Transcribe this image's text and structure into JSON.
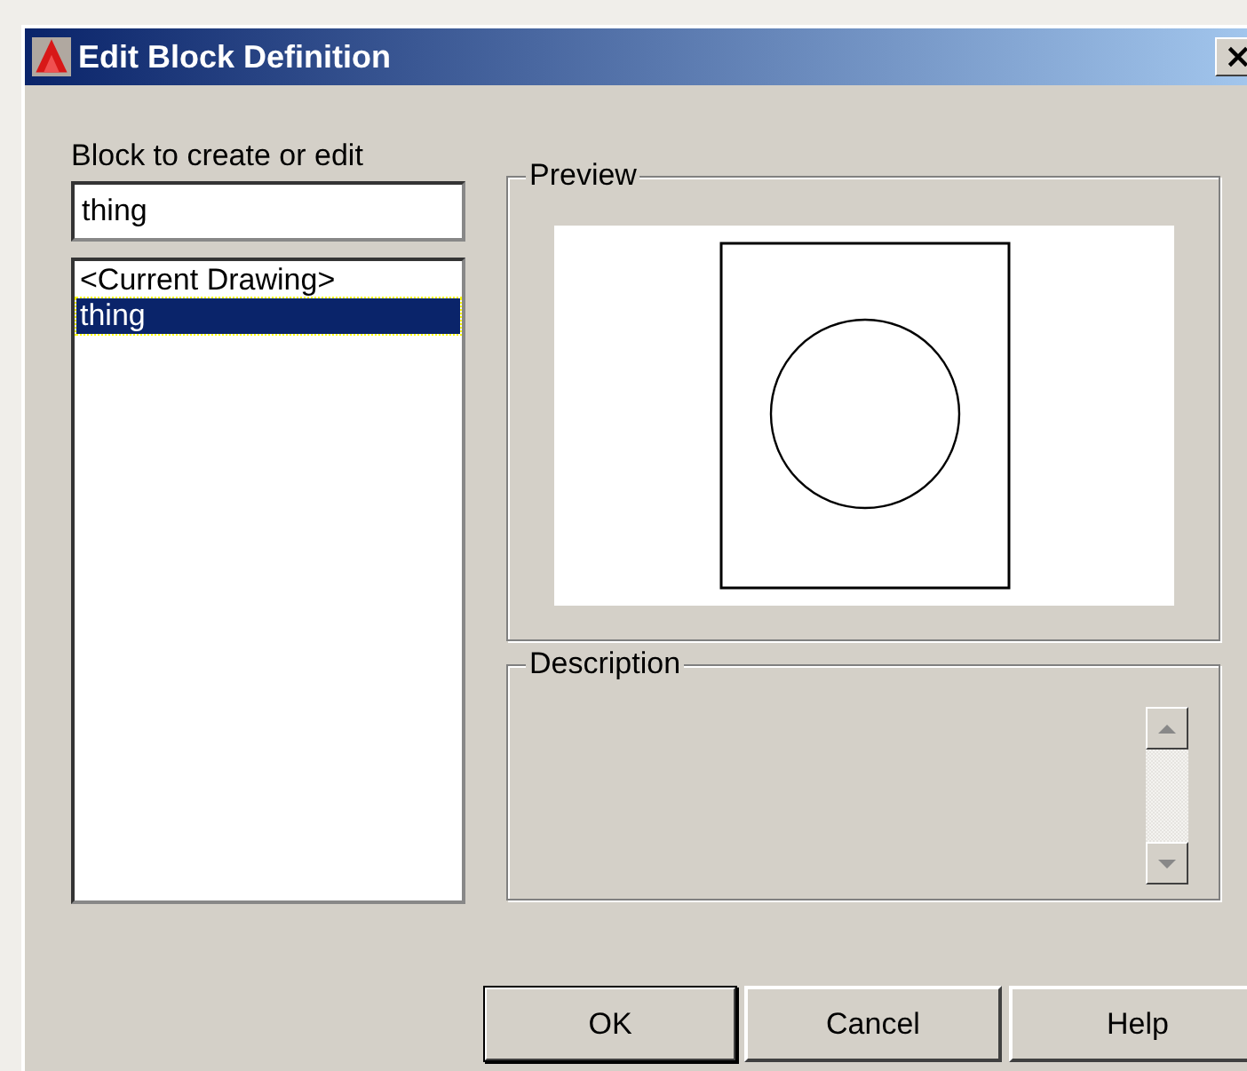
{
  "window": {
    "title": "Edit Block Definition"
  },
  "block_field": {
    "label": "Block to create or edit",
    "value": "thing"
  },
  "block_list": [
    {
      "label": "<Current Drawing>",
      "selected": false
    },
    {
      "label": "thing",
      "selected": true
    }
  ],
  "preview": {
    "title": "Preview"
  },
  "description": {
    "title": "Description"
  },
  "buttons": [
    {
      "label": "OK",
      "default": true
    },
    {
      "label": "Cancel",
      "default": false
    },
    {
      "label": "Help",
      "default": false
    }
  ]
}
